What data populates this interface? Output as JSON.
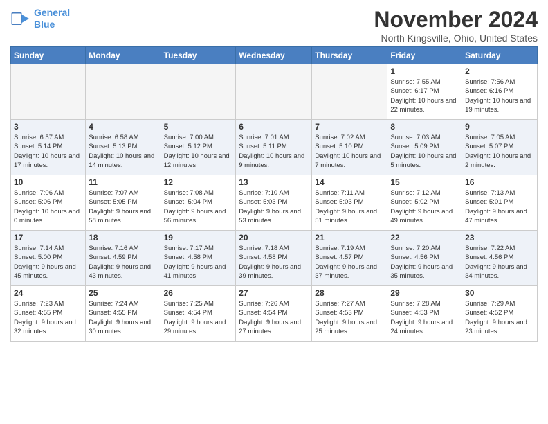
{
  "header": {
    "logo_line1": "General",
    "logo_line2": "Blue",
    "month": "November 2024",
    "location": "North Kingsville, Ohio, United States"
  },
  "columns": [
    "Sunday",
    "Monday",
    "Tuesday",
    "Wednesday",
    "Thursday",
    "Friday",
    "Saturday"
  ],
  "weeks": [
    [
      {
        "day": "",
        "info": ""
      },
      {
        "day": "",
        "info": ""
      },
      {
        "day": "",
        "info": ""
      },
      {
        "day": "",
        "info": ""
      },
      {
        "day": "",
        "info": ""
      },
      {
        "day": "1",
        "info": "Sunrise: 7:55 AM\nSunset: 6:17 PM\nDaylight: 10 hours and 22 minutes."
      },
      {
        "day": "2",
        "info": "Sunrise: 7:56 AM\nSunset: 6:16 PM\nDaylight: 10 hours and 19 minutes."
      }
    ],
    [
      {
        "day": "3",
        "info": "Sunrise: 6:57 AM\nSunset: 5:14 PM\nDaylight: 10 hours and 17 minutes."
      },
      {
        "day": "4",
        "info": "Sunrise: 6:58 AM\nSunset: 5:13 PM\nDaylight: 10 hours and 14 minutes."
      },
      {
        "day": "5",
        "info": "Sunrise: 7:00 AM\nSunset: 5:12 PM\nDaylight: 10 hours and 12 minutes."
      },
      {
        "day": "6",
        "info": "Sunrise: 7:01 AM\nSunset: 5:11 PM\nDaylight: 10 hours and 9 minutes."
      },
      {
        "day": "7",
        "info": "Sunrise: 7:02 AM\nSunset: 5:10 PM\nDaylight: 10 hours and 7 minutes."
      },
      {
        "day": "8",
        "info": "Sunrise: 7:03 AM\nSunset: 5:09 PM\nDaylight: 10 hours and 5 minutes."
      },
      {
        "day": "9",
        "info": "Sunrise: 7:05 AM\nSunset: 5:07 PM\nDaylight: 10 hours and 2 minutes."
      }
    ],
    [
      {
        "day": "10",
        "info": "Sunrise: 7:06 AM\nSunset: 5:06 PM\nDaylight: 10 hours and 0 minutes."
      },
      {
        "day": "11",
        "info": "Sunrise: 7:07 AM\nSunset: 5:05 PM\nDaylight: 9 hours and 58 minutes."
      },
      {
        "day": "12",
        "info": "Sunrise: 7:08 AM\nSunset: 5:04 PM\nDaylight: 9 hours and 56 minutes."
      },
      {
        "day": "13",
        "info": "Sunrise: 7:10 AM\nSunset: 5:03 PM\nDaylight: 9 hours and 53 minutes."
      },
      {
        "day": "14",
        "info": "Sunrise: 7:11 AM\nSunset: 5:03 PM\nDaylight: 9 hours and 51 minutes."
      },
      {
        "day": "15",
        "info": "Sunrise: 7:12 AM\nSunset: 5:02 PM\nDaylight: 9 hours and 49 minutes."
      },
      {
        "day": "16",
        "info": "Sunrise: 7:13 AM\nSunset: 5:01 PM\nDaylight: 9 hours and 47 minutes."
      }
    ],
    [
      {
        "day": "17",
        "info": "Sunrise: 7:14 AM\nSunset: 5:00 PM\nDaylight: 9 hours and 45 minutes."
      },
      {
        "day": "18",
        "info": "Sunrise: 7:16 AM\nSunset: 4:59 PM\nDaylight: 9 hours and 43 minutes."
      },
      {
        "day": "19",
        "info": "Sunrise: 7:17 AM\nSunset: 4:58 PM\nDaylight: 9 hours and 41 minutes."
      },
      {
        "day": "20",
        "info": "Sunrise: 7:18 AM\nSunset: 4:58 PM\nDaylight: 9 hours and 39 minutes."
      },
      {
        "day": "21",
        "info": "Sunrise: 7:19 AM\nSunset: 4:57 PM\nDaylight: 9 hours and 37 minutes."
      },
      {
        "day": "22",
        "info": "Sunrise: 7:20 AM\nSunset: 4:56 PM\nDaylight: 9 hours and 35 minutes."
      },
      {
        "day": "23",
        "info": "Sunrise: 7:22 AM\nSunset: 4:56 PM\nDaylight: 9 hours and 34 minutes."
      }
    ],
    [
      {
        "day": "24",
        "info": "Sunrise: 7:23 AM\nSunset: 4:55 PM\nDaylight: 9 hours and 32 minutes."
      },
      {
        "day": "25",
        "info": "Sunrise: 7:24 AM\nSunset: 4:55 PM\nDaylight: 9 hours and 30 minutes."
      },
      {
        "day": "26",
        "info": "Sunrise: 7:25 AM\nSunset: 4:54 PM\nDaylight: 9 hours and 29 minutes."
      },
      {
        "day": "27",
        "info": "Sunrise: 7:26 AM\nSunset: 4:54 PM\nDaylight: 9 hours and 27 minutes."
      },
      {
        "day": "28",
        "info": "Sunrise: 7:27 AM\nSunset: 4:53 PM\nDaylight: 9 hours and 25 minutes."
      },
      {
        "day": "29",
        "info": "Sunrise: 7:28 AM\nSunset: 4:53 PM\nDaylight: 9 hours and 24 minutes."
      },
      {
        "day": "30",
        "info": "Sunrise: 7:29 AM\nSunset: 4:52 PM\nDaylight: 9 hours and 23 minutes."
      }
    ]
  ]
}
